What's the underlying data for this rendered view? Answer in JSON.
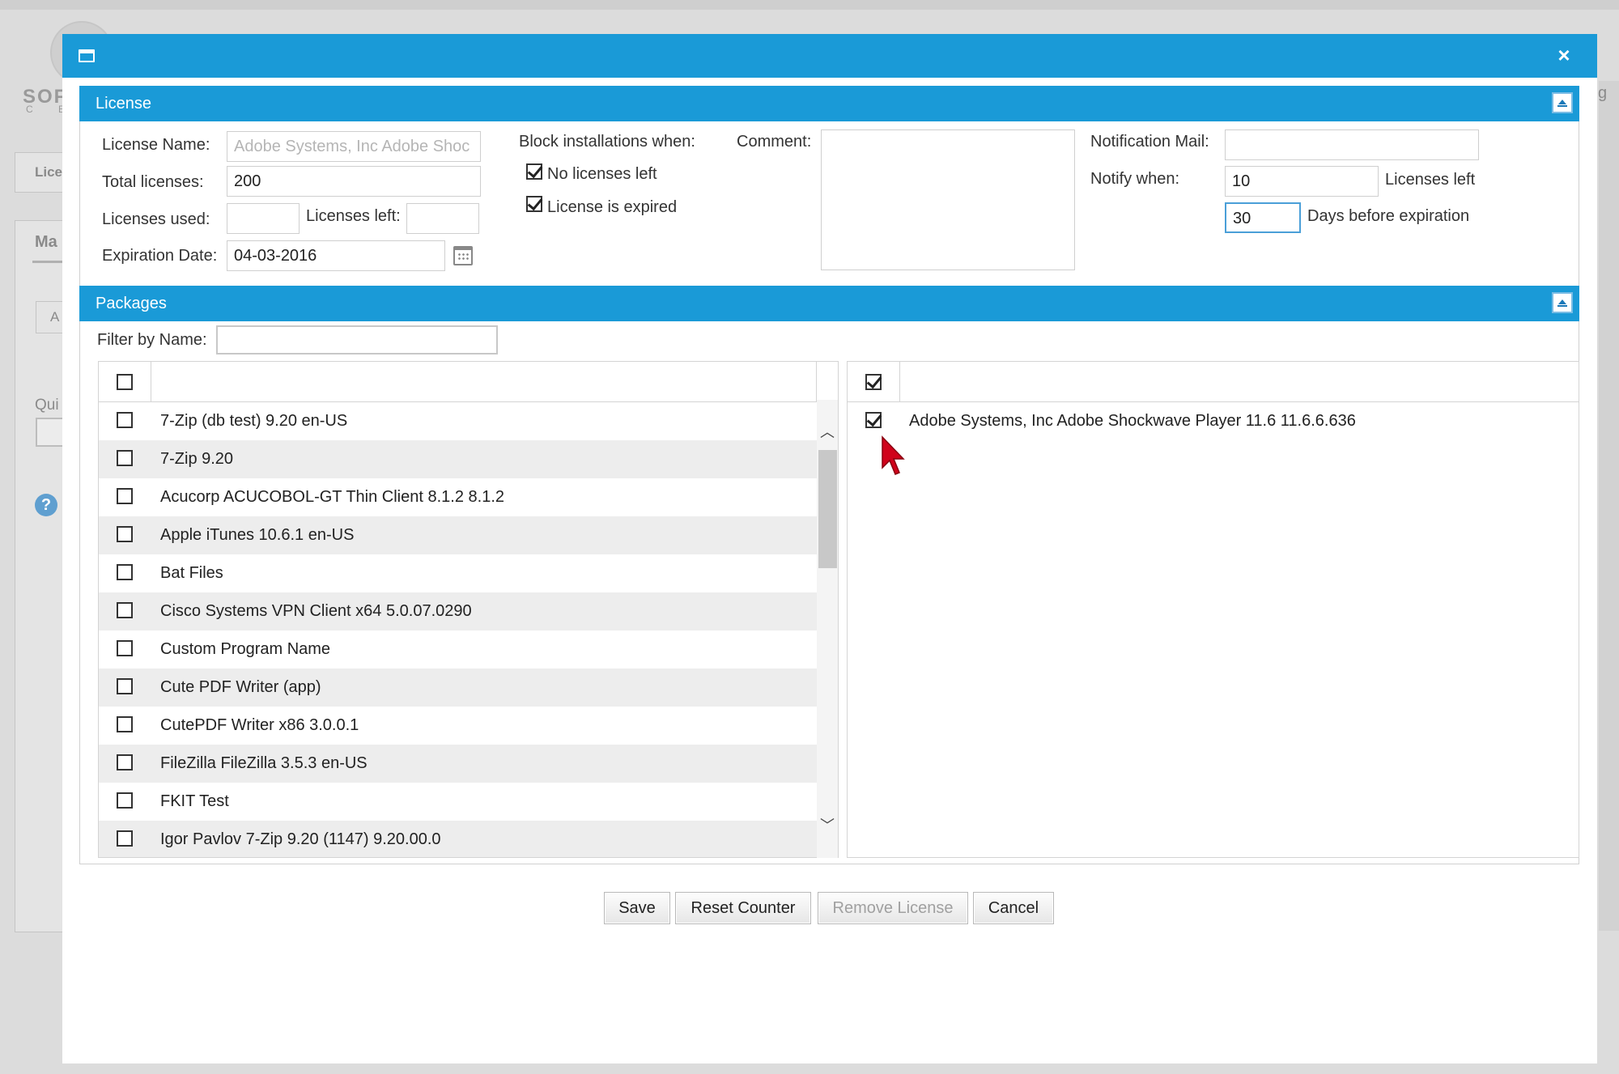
{
  "background": {
    "logo_text": "SOF",
    "logo_sub": "C E",
    "tab_label": "Lice",
    "section_label": "Ma",
    "button_label": "A",
    "quick_label": "Qui",
    "right_edge_text": "g",
    "help_glyph": "?"
  },
  "dialog": {
    "close_glyph": "×"
  },
  "license": {
    "section_title": "License",
    "license_name_label": "License Name:",
    "license_name_placeholder": "Adobe Systems, Inc Adobe Shoc",
    "total_licenses_label": "Total licenses:",
    "total_licenses_value": "200",
    "licenses_used_label": "Licenses used:",
    "licenses_used_value": "",
    "licenses_left_label": "Licenses left:",
    "licenses_left_value": "",
    "expiration_date_label": "Expiration Date:",
    "expiration_date_value": "04-03-2016",
    "block_label": "Block installations when:",
    "no_licenses_left_label": "No licenses left",
    "no_licenses_left_checked": true,
    "license_expired_label": "License is expired",
    "license_expired_checked": true,
    "comment_label": "Comment:",
    "comment_value": "",
    "notification_mail_label": "Notification Mail:",
    "notification_mail_value": "",
    "notify_when_label": "Notify when:",
    "notify_licenses_value": "10",
    "licenses_left_suffix": "Licenses left",
    "notify_days_value": "30",
    "days_before_suffix": "Days before expiration"
  },
  "packages": {
    "section_title": "Packages",
    "filter_label": "Filter by Name:",
    "filter_value": "",
    "available": [
      {
        "name": "7-Zip (db test) 9.20 en-US",
        "checked": false
      },
      {
        "name": "7-Zip 9.20",
        "checked": false
      },
      {
        "name": "Acucorp ACUCOBOL-GT Thin Client 8.1.2 8.1.2",
        "checked": false
      },
      {
        "name": "Apple iTunes 10.6.1 en-US",
        "checked": false
      },
      {
        "name": "Bat Files",
        "checked": false
      },
      {
        "name": "Cisco Systems VPN Client x64 5.0.07.0290",
        "checked": false
      },
      {
        "name": "Custom Program Name",
        "checked": false
      },
      {
        "name": "Cute PDF Writer (app)",
        "checked": false
      },
      {
        "name": "CutePDF Writer x86 3.0.0.1",
        "checked": false
      },
      {
        "name": "FileZilla FileZilla 3.5.3 en-US",
        "checked": false
      },
      {
        "name": "FKIT Test",
        "checked": false
      },
      {
        "name": "Igor Pavlov 7-Zip 9.20 (1147) 9.20.00.0",
        "checked": false
      }
    ],
    "selected": [
      {
        "name": "Adobe Systems, Inc Adobe Shockwave Player 11.6 11.6.6.636",
        "checked": true
      }
    ],
    "scroll_up_glyph": "︿",
    "scroll_down_glyph": "﹀"
  },
  "buttons": {
    "save": "Save",
    "reset_counter": "Reset Counter",
    "remove_license": "Remove License",
    "cancel": "Cancel"
  },
  "colors": {
    "accent": "#1a9ad7",
    "cursor": "#d0021b"
  }
}
